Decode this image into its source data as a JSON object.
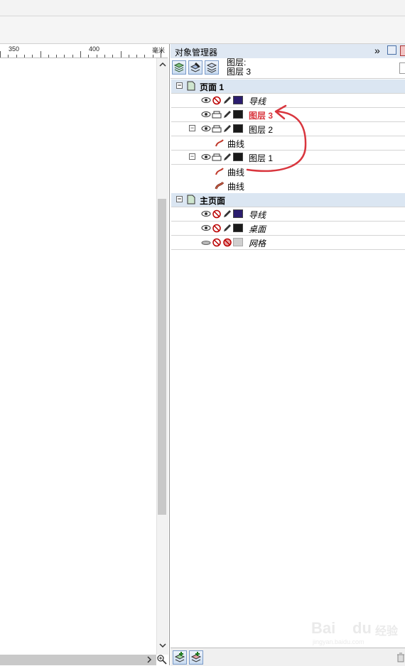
{
  "ruler": {
    "labels": [
      "350",
      "400"
    ],
    "unit": "毫米"
  },
  "docker": {
    "title": "对象管理器",
    "collapse_glyph": "»",
    "current_layer_label": "图层:",
    "current_layer_value": "图层 3"
  },
  "tree": {
    "page1": {
      "label": "页面 1",
      "rows": {
        "guides": "导线",
        "layer3": "图层 3",
        "layer2": "图层 2",
        "layer2_curve": "曲线",
        "layer1": "图层 1",
        "layer1_curve1": "曲线",
        "layer1_curve2": "曲线"
      }
    },
    "master": {
      "label": "主页面",
      "rows": {
        "guides": "导线",
        "desktop": "桌面",
        "grid": "网格"
      }
    }
  },
  "colors": {
    "accent_annotation": "#d9363e",
    "guides_swatch": "#2b1d6e",
    "layer_swatch": "#1a1a1a",
    "grid_swatch": "#cfcfcf",
    "page_row_bg": "#dbe6f2"
  },
  "icons": [
    "eye-icon",
    "printer-icon",
    "no-print-icon",
    "pencil-icon",
    "page-icon",
    "curve-icon",
    "new-layer-icon",
    "new-master-layer-icon",
    "zoom-icon",
    "trash-icon"
  ],
  "watermark": {
    "brand": "Bai",
    "brand2": "du",
    "sub": "经验",
    "url": "jingyan.baidu.com"
  }
}
